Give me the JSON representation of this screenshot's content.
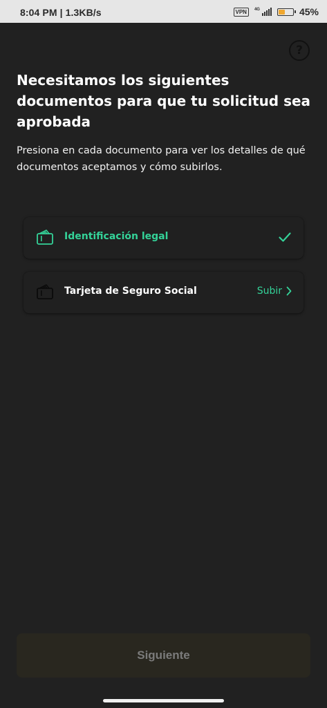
{
  "status_bar": {
    "time": "8:04 PM | 1.3KB/s",
    "vpn": "VPN",
    "network": "4G",
    "battery_percent": "45%",
    "battery_level": 0.45
  },
  "header": {
    "help_icon": "question-circle-icon",
    "help_symbol": "?"
  },
  "main": {
    "title": "Necesitamos los siguientes documentos para que tu solicitud sea aprobada",
    "subtitle": "Presiona en cada documento para ver los detalles de qué documentos aceptamos y cómo subirlos.",
    "documents": [
      {
        "label": "Identificación legal",
        "icon": "wallet-icon",
        "status": "completed",
        "status_icon": "check-icon"
      },
      {
        "label": "Tarjeta de Seguro Social",
        "icon": "wallet-icon",
        "status": "pending",
        "action_label": "Subir",
        "action_icon": "chevron-right-icon"
      }
    ]
  },
  "footer": {
    "next_label": "Siguiente",
    "next_enabled": false
  },
  "colors": {
    "background": "#212121",
    "accent": "#34d399",
    "disabled_button": "#29271f",
    "disabled_text": "#7b7b7b"
  }
}
